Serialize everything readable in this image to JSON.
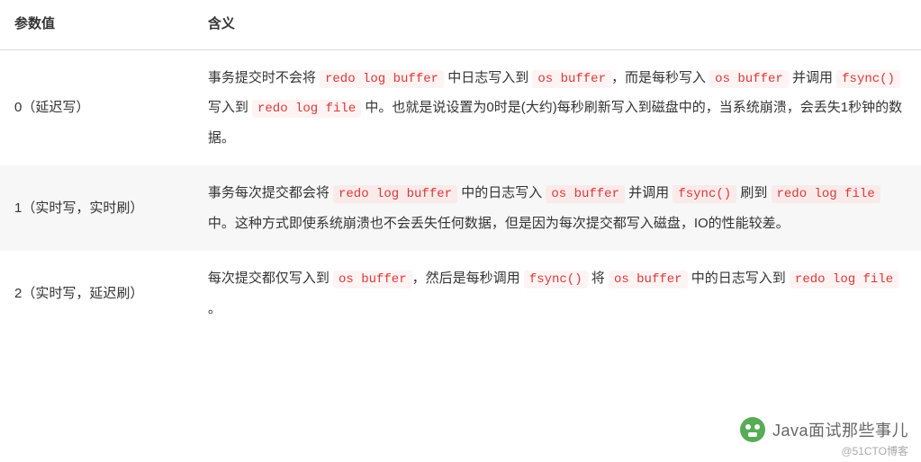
{
  "table": {
    "headers": {
      "param": "参数值",
      "desc": "含义"
    },
    "rows": [
      {
        "param": "0（延迟写）",
        "desc_parts": [
          {
            "t": "text",
            "v": "事务提交时不会将 "
          },
          {
            "t": "code",
            "v": "redo log buffer"
          },
          {
            "t": "text",
            "v": " 中日志写入到 "
          },
          {
            "t": "code",
            "v": "os buffer"
          },
          {
            "t": "text",
            "v": "，而是每秒写入 "
          },
          {
            "t": "code",
            "v": "os buffer"
          },
          {
            "t": "text",
            "v": " 并调用 "
          },
          {
            "t": "code",
            "v": "fsync()"
          },
          {
            "t": "text",
            "v": " 写入到 "
          },
          {
            "t": "code",
            "v": "redo log file"
          },
          {
            "t": "text",
            "v": " 中。也就是说设置为0时是(大约)每秒刷新写入到磁盘中的，当系统崩溃，会丢失1秒钟的数据。"
          }
        ]
      },
      {
        "param": "1（实时写，实时刷）",
        "desc_parts": [
          {
            "t": "text",
            "v": "事务每次提交都会将 "
          },
          {
            "t": "code",
            "v": "redo log buffer"
          },
          {
            "t": "text",
            "v": " 中的日志写入 "
          },
          {
            "t": "code",
            "v": "os buffer"
          },
          {
            "t": "text",
            "v": " 并调用 "
          },
          {
            "t": "code",
            "v": "fsync()"
          },
          {
            "t": "text",
            "v": " 刷到 "
          },
          {
            "t": "code",
            "v": "redo log file"
          },
          {
            "t": "text",
            "v": " 中。这种方式即使系统崩溃也不会丢失任何数据，但是因为每次提交都写入磁盘，IO的性能较差。"
          }
        ]
      },
      {
        "param": "2（实时写，延迟刷）",
        "desc_parts": [
          {
            "t": "text",
            "v": "每次提交都仅写入到 "
          },
          {
            "t": "code",
            "v": "os buffer"
          },
          {
            "t": "text",
            "v": "，然后是每秒调用 "
          },
          {
            "t": "code",
            "v": "fsync()"
          },
          {
            "t": "text",
            "v": " 将 "
          },
          {
            "t": "code",
            "v": "os buffer"
          },
          {
            "t": "text",
            "v": " 中的日志写入到 "
          },
          {
            "t": "code",
            "v": "redo log file"
          },
          {
            "t": "text",
            "v": " 。"
          }
        ]
      }
    ]
  },
  "watermark": {
    "main": "Java面试那些事儿",
    "sub": "@51CTO博客"
  }
}
